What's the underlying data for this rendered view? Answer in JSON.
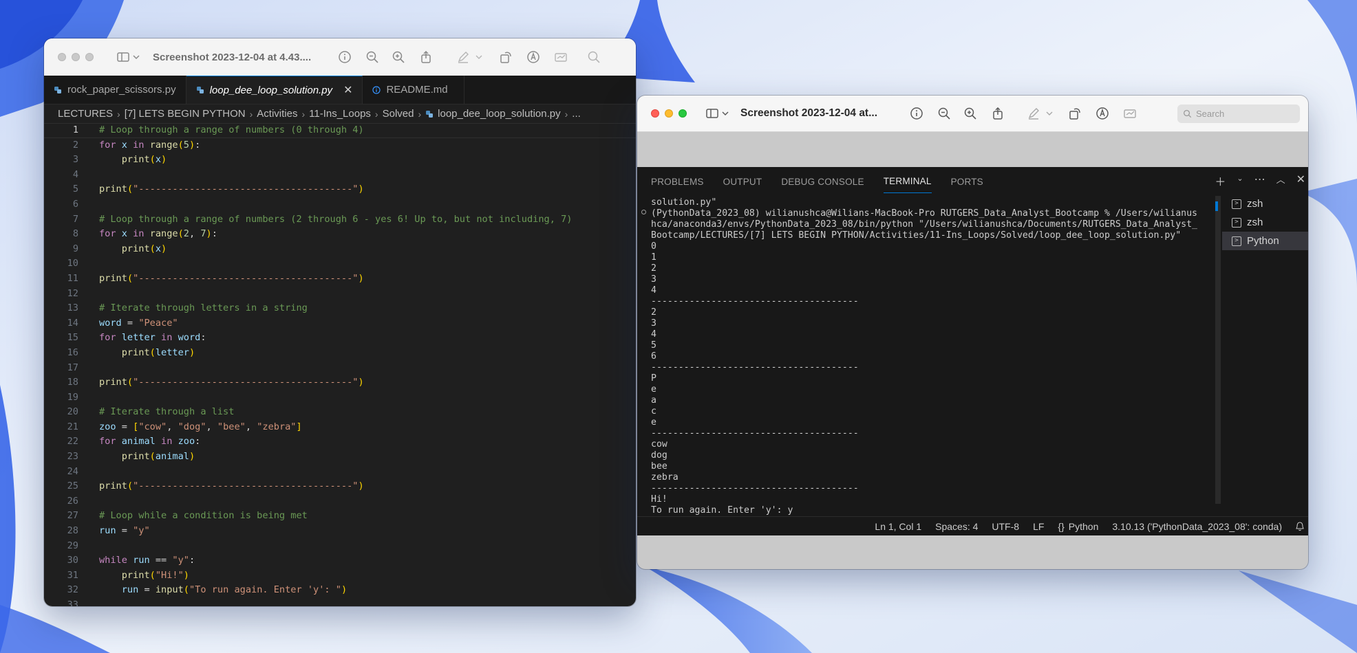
{
  "colors": {
    "editor_bg": "#1f1f1f",
    "accent": "#0078d4",
    "comment": "#6a9955",
    "keyword": "#c586c0",
    "string": "#ce9178"
  },
  "left_window": {
    "title": "Screenshot 2023-12-04 at 4.43....",
    "toolbar_icons": [
      "sidebar-icon",
      "chevron-down-icon",
      "info-icon",
      "zoom-out-icon",
      "zoom-in-icon",
      "share-icon",
      "markup-icon",
      "chevron-down-icon",
      "rotate-icon",
      "markup-circle-icon",
      "signature-icon",
      "search-icon"
    ],
    "tabs": [
      {
        "label": "rock_paper_scissors.py",
        "icon": "python-icon"
      },
      {
        "label": "loop_dee_loop_solution.py",
        "icon": "python-icon",
        "active": true
      },
      {
        "label": "README.md",
        "icon": "info-icon"
      }
    ],
    "breadcrumb": [
      "LECTURES",
      "[7] LETS BEGIN PYTHON",
      "Activities",
      "11-Ins_Loops",
      "Solved",
      "loop_dee_loop_solution.py",
      "..."
    ],
    "code_lines": [
      {
        "n": "1",
        "toks": [
          [
            "c",
            "# Loop through a range of numbers (0 through 4)"
          ]
        ]
      },
      {
        "n": "2",
        "toks": [
          [
            "k",
            "for"
          ],
          [
            "p",
            " "
          ],
          [
            "v",
            "x"
          ],
          [
            "p",
            " "
          ],
          [
            "k",
            "in"
          ],
          [
            "p",
            " "
          ],
          [
            "b",
            "range"
          ],
          [
            "y",
            "("
          ],
          [
            "n",
            "5"
          ],
          [
            "y",
            ")"
          ],
          [
            "p",
            ":"
          ]
        ]
      },
      {
        "n": "3",
        "toks": [
          [
            "p",
            "    "
          ],
          [
            "b",
            "print"
          ],
          [
            "y",
            "("
          ],
          [
            "v",
            "x"
          ],
          [
            "y",
            ")"
          ]
        ]
      },
      {
        "n": "4",
        "toks": []
      },
      {
        "n": "5",
        "toks": [
          [
            "b",
            "print"
          ],
          [
            "y",
            "("
          ],
          [
            "s",
            "\"--------------------------------------\""
          ],
          [
            "y",
            ")"
          ]
        ]
      },
      {
        "n": "6",
        "toks": []
      },
      {
        "n": "7",
        "toks": [
          [
            "c",
            "# Loop through a range of numbers (2 through 6 - yes 6! Up to, but not including, 7)"
          ]
        ]
      },
      {
        "n": "8",
        "toks": [
          [
            "k",
            "for"
          ],
          [
            "p",
            " "
          ],
          [
            "v",
            "x"
          ],
          [
            "p",
            " "
          ],
          [
            "k",
            "in"
          ],
          [
            "p",
            " "
          ],
          [
            "b",
            "range"
          ],
          [
            "y",
            "("
          ],
          [
            "n",
            "2"
          ],
          [
            "p",
            ", "
          ],
          [
            "n",
            "7"
          ],
          [
            "y",
            ")"
          ],
          [
            "p",
            ":"
          ]
        ]
      },
      {
        "n": "9",
        "toks": [
          [
            "p",
            "    "
          ],
          [
            "b",
            "print"
          ],
          [
            "y",
            "("
          ],
          [
            "v",
            "x"
          ],
          [
            "y",
            ")"
          ]
        ]
      },
      {
        "n": "10",
        "toks": []
      },
      {
        "n": "11",
        "toks": [
          [
            "b",
            "print"
          ],
          [
            "y",
            "("
          ],
          [
            "s",
            "\"--------------------------------------\""
          ],
          [
            "y",
            ")"
          ]
        ]
      },
      {
        "n": "12",
        "toks": []
      },
      {
        "n": "13",
        "toks": [
          [
            "c",
            "# Iterate through letters in a string"
          ]
        ]
      },
      {
        "n": "14",
        "toks": [
          [
            "v",
            "word"
          ],
          [
            "p",
            " = "
          ],
          [
            "s",
            "\"Peace\""
          ]
        ]
      },
      {
        "n": "15",
        "toks": [
          [
            "k",
            "for"
          ],
          [
            "p",
            " "
          ],
          [
            "v",
            "letter"
          ],
          [
            "p",
            " "
          ],
          [
            "k",
            "in"
          ],
          [
            "p",
            " "
          ],
          [
            "v",
            "word"
          ],
          [
            "p",
            ":"
          ]
        ]
      },
      {
        "n": "16",
        "toks": [
          [
            "p",
            "    "
          ],
          [
            "b",
            "print"
          ],
          [
            "y",
            "("
          ],
          [
            "v",
            "letter"
          ],
          [
            "y",
            ")"
          ]
        ]
      },
      {
        "n": "17",
        "toks": []
      },
      {
        "n": "18",
        "toks": [
          [
            "b",
            "print"
          ],
          [
            "y",
            "("
          ],
          [
            "s",
            "\"--------------------------------------\""
          ],
          [
            "y",
            ")"
          ]
        ]
      },
      {
        "n": "19",
        "toks": []
      },
      {
        "n": "20",
        "toks": [
          [
            "c",
            "# Iterate through a list"
          ]
        ]
      },
      {
        "n": "21",
        "toks": [
          [
            "v",
            "zoo"
          ],
          [
            "p",
            " = "
          ],
          [
            "y",
            "["
          ],
          [
            "s",
            "\"cow\""
          ],
          [
            "p",
            ", "
          ],
          [
            "s",
            "\"dog\""
          ],
          [
            "p",
            ", "
          ],
          [
            "s",
            "\"bee\""
          ],
          [
            "p",
            ", "
          ],
          [
            "s",
            "\"zebra\""
          ],
          [
            "y",
            "]"
          ]
        ]
      },
      {
        "n": "22",
        "toks": [
          [
            "k",
            "for"
          ],
          [
            "p",
            " "
          ],
          [
            "v",
            "animal"
          ],
          [
            "p",
            " "
          ],
          [
            "k",
            "in"
          ],
          [
            "p",
            " "
          ],
          [
            "v",
            "zoo"
          ],
          [
            "p",
            ":"
          ]
        ]
      },
      {
        "n": "23",
        "toks": [
          [
            "p",
            "    "
          ],
          [
            "b",
            "print"
          ],
          [
            "y",
            "("
          ],
          [
            "v",
            "animal"
          ],
          [
            "y",
            ")"
          ]
        ]
      },
      {
        "n": "24",
        "toks": []
      },
      {
        "n": "25",
        "toks": [
          [
            "b",
            "print"
          ],
          [
            "y",
            "("
          ],
          [
            "s",
            "\"--------------------------------------\""
          ],
          [
            "y",
            ")"
          ]
        ]
      },
      {
        "n": "26",
        "toks": []
      },
      {
        "n": "27",
        "toks": [
          [
            "c",
            "# Loop while a condition is being met"
          ]
        ]
      },
      {
        "n": "28",
        "toks": [
          [
            "v",
            "run"
          ],
          [
            "p",
            " = "
          ],
          [
            "s",
            "\"y\""
          ]
        ]
      },
      {
        "n": "29",
        "toks": []
      },
      {
        "n": "30",
        "toks": [
          [
            "k",
            "while"
          ],
          [
            "p",
            " "
          ],
          [
            "v",
            "run"
          ],
          [
            "p",
            " == "
          ],
          [
            "s",
            "\"y\""
          ],
          [
            "p",
            ":"
          ]
        ]
      },
      {
        "n": "31",
        "toks": [
          [
            "p",
            "    "
          ],
          [
            "b",
            "print"
          ],
          [
            "y",
            "("
          ],
          [
            "s",
            "\"Hi!\""
          ],
          [
            "y",
            ")"
          ]
        ]
      },
      {
        "n": "32",
        "toks": [
          [
            "p",
            "    "
          ],
          [
            "v",
            "run"
          ],
          [
            "p",
            " = "
          ],
          [
            "b",
            "input"
          ],
          [
            "y",
            "("
          ],
          [
            "s",
            "\"To run again. Enter 'y': \""
          ],
          [
            "y",
            ")"
          ]
        ]
      },
      {
        "n": "33",
        "toks": []
      }
    ]
  },
  "right_window": {
    "title": "Screenshot 2023-12-04 at...",
    "search_placeholder": "Search",
    "panel_tabs": [
      "PROBLEMS",
      "OUTPUT",
      "DEBUG CONSOLE",
      "TERMINAL",
      "PORTS"
    ],
    "active_panel_tab": "TERMINAL",
    "terminal_lines": [
      "solution.py\"",
      "(PythonData_2023_08) wilianushca@Wilians-MacBook-Pro RUTGERS_Data_Analyst_Bootcamp % /Users/wilianus",
      "hca/anaconda3/envs/PythonData_2023_08/bin/python \"/Users/wilianushca/Documents/RUTGERS_Data_Analyst_",
      "Bootcamp/LECTURES/[7] LETS BEGIN PYTHON/Activities/11-Ins_Loops/Solved/loop_dee_loop_solution.py\"",
      "0",
      "1",
      "2",
      "3",
      "4",
      "--------------------------------------",
      "2",
      "3",
      "4",
      "5",
      "6",
      "--------------------------------------",
      "P",
      "e",
      "a",
      "c",
      "e",
      "--------------------------------------",
      "cow",
      "dog",
      "bee",
      "zebra",
      "--------------------------------------",
      "Hi!",
      "To run again. Enter 'y': y"
    ],
    "terminals": [
      {
        "label": "zsh"
      },
      {
        "label": "zsh"
      },
      {
        "label": "Python",
        "active": true
      }
    ],
    "status": {
      "position": "Ln 1, Col 1",
      "spaces": "Spaces: 4",
      "encoding": "UTF-8",
      "eol": "LF",
      "language": "Python",
      "interpreter": "3.10.13 ('PythonData_2023_08': conda)"
    }
  }
}
